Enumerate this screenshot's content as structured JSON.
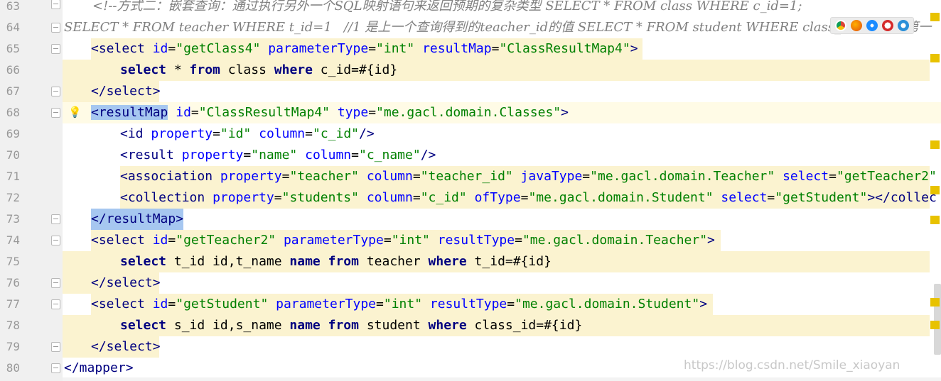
{
  "lines": [
    {
      "num": "63",
      "code": "<!--方式二：嵌套查询：通过执行另外一个SQL映射语句来返回预期的复杂类型 SELECT * FROM class WHERE c_id=1;"
    },
    {
      "num": "64",
      "code": "SELECT * FROM teacher WHERE t_id=1   //1 是上一个查询得到的teacher_id的值 SELECT * FROM student WHERE class_id=1 //1是第一"
    },
    {
      "num": "65",
      "tag_open": "<select",
      "a1": "id",
      "v1": "\"getClass4\"",
      "a2": "parameterType",
      "v2": "\"int\"",
      "a3": "resultMap",
      "v3": "\"ClassResultMap4\"",
      "tag_close": ">"
    },
    {
      "num": "66",
      "k1": "select",
      "p1": " * ",
      "k2": "from",
      "p2": " class ",
      "k3": "where",
      "p3": " c_id=#{id}"
    },
    {
      "num": "67",
      "code": "</select>"
    },
    {
      "num": "68",
      "tag_lt": "<",
      "tag_name": "resultMap",
      "a1": "id",
      "v1": "\"ClassResultMap4\"",
      "a2": "type",
      "v2": "\"me.gacl.domain.Classes\"",
      "tag_close": ">"
    },
    {
      "num": "69",
      "tag_open": "<id",
      "a1": "property",
      "v1": "\"id\"",
      "a2": "column",
      "v2": "\"c_id\"",
      "tag_close": "/>"
    },
    {
      "num": "70",
      "tag_open": "<result",
      "a1": "property",
      "v1": "\"name\"",
      "a2": "column",
      "v2": "\"c_name\"",
      "tag_close": "/>"
    },
    {
      "num": "71",
      "tag_open": "<association",
      "a1": "property",
      "v1": "\"teacher\"",
      "a2": "column",
      "v2": "\"teacher_id\"",
      "a3": "javaType",
      "v3": "\"me.gacl.domain.Teacher\"",
      "a4": "select",
      "v4": "\"getTeacher2\""
    },
    {
      "num": "72",
      "tag_open": "<collection",
      "a1": "property",
      "v1": "\"students\"",
      "a2": "column",
      "v2": "\"c_id\"",
      "a3": "ofType",
      "v3": "\"me.gacl.domain.Student\"",
      "a4": "select",
      "v4": "\"getStudent\"",
      "tag_close": "></collec"
    },
    {
      "num": "73",
      "code": "</resultMap>"
    },
    {
      "num": "74",
      "tag_open": "<select",
      "a1": "id",
      "v1": "\"getTeacher2\"",
      "a2": "parameterType",
      "v2": "\"int\"",
      "a3": "resultType",
      "v3": "\"me.gacl.domain.Teacher\"",
      "tag_close": ">"
    },
    {
      "num": "75",
      "k1": "select",
      "p1": " t_id id,t_name ",
      "k2": "name",
      "p2": " ",
      "k3": "from",
      "p3": " teacher ",
      "k4": "where",
      "p4": " t_id=#{id}"
    },
    {
      "num": "76",
      "code": "</select>"
    },
    {
      "num": "77",
      "tag_open": "<select",
      "a1": "id",
      "v1": "\"getStudent\"",
      "a2": "parameterType",
      "v2": "\"int\"",
      "a3": "resultType",
      "v3": "\"me.gacl.domain.Student\"",
      "tag_close": ">"
    },
    {
      "num": "78",
      "k1": "select",
      "p1": " s_id id,s_name ",
      "k2": "name",
      "p2": " ",
      "k3": "from",
      "p3": " student ",
      "k4": "where",
      "p4": " class_id=#{id}"
    },
    {
      "num": "79",
      "code": "</select>"
    },
    {
      "num": "80",
      "code": "</mapper>"
    }
  ],
  "browser_icons": [
    "chrome-icon",
    "firefox-icon",
    "safari-icon",
    "opera-icon",
    "ie-icon"
  ],
  "watermark": "https://blog.csdn.net/Smile_xiaoyan",
  "colors": {
    "tag": "#000080",
    "attribute": "#0000ff",
    "value": "#008000",
    "comment": "#808080",
    "highlight": "#fbf3d0",
    "tag_match": "#a6c7f0"
  }
}
